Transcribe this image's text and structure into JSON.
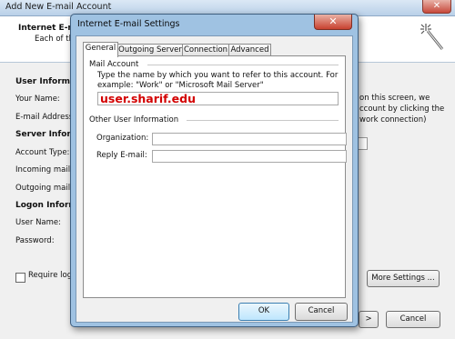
{
  "background_window": {
    "title": "Add New E-mail Account",
    "close_glyph": "✕",
    "header_title": "Internet E-m",
    "header_subtitle": "Each of th",
    "section_user": "User Informa",
    "label_your_name": "Your Name:",
    "label_email": "E-mail Address:",
    "section_server": "Server Inform",
    "label_account_type": "Account Type:",
    "label_incoming": "Incoming mail se",
    "label_outgoing": "Outgoing mail se",
    "section_logon": "Logon Inform",
    "label_username": "User Name:",
    "label_password": "Password:",
    "require_logon_label": "Require logo",
    "right_text_1": "on this screen, we",
    "right_text_2": "ccount by clicking the",
    "right_text_3": "work connection)",
    "more_settings_label": "More Settings ...",
    "next_label": ">",
    "cancel_label": "Cancel"
  },
  "dialog": {
    "title": "Internet E-mail Settings",
    "close_glyph": "✕",
    "tabs": [
      {
        "label": "General"
      },
      {
        "label": "Outgoing Server"
      },
      {
        "label": "Connection"
      },
      {
        "label": "Advanced"
      }
    ],
    "mail_account_group": "Mail Account",
    "mail_account_desc": "Type the name by which you want to refer to this account. For example: \"Work\" or \"Microsoft Mail Server\"",
    "account_name_value": "user.sharif.edu",
    "other_info_group": "Other User Information",
    "organization_label": "Organization:",
    "organization_value": "",
    "reply_email_label": "Reply E-mail:",
    "reply_email_value": "",
    "ok_label": "OK",
    "cancel_label": "Cancel"
  },
  "colors": {
    "account_text": "#d30000",
    "dialog_frame": "#9fc2e2"
  }
}
